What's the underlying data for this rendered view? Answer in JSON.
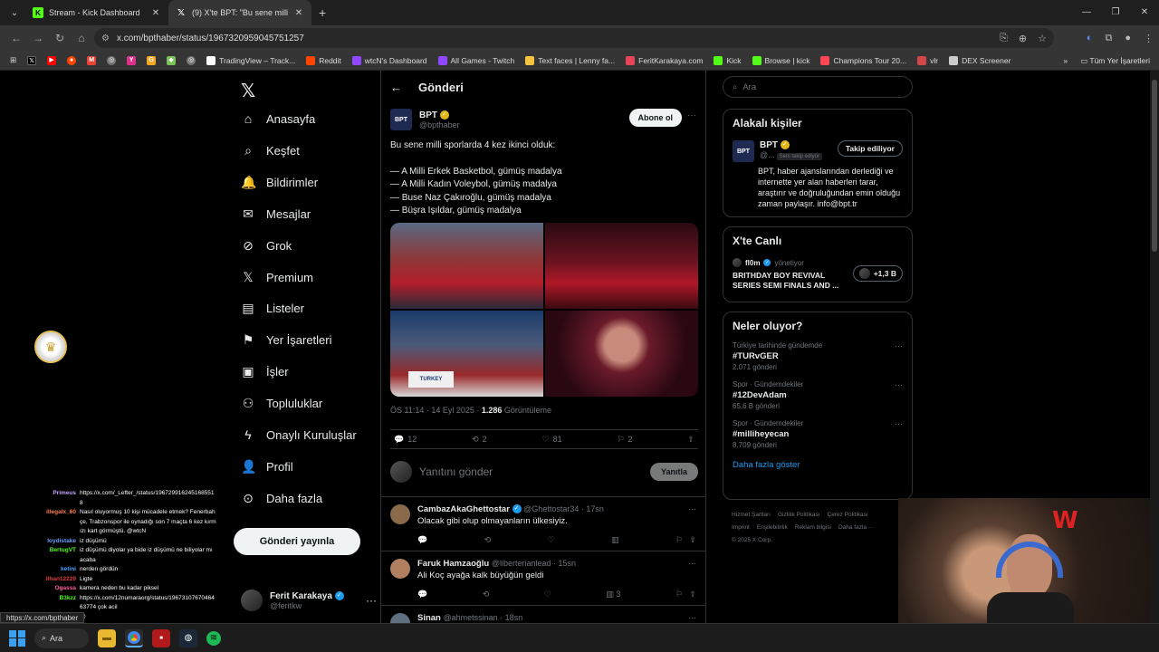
{
  "browser": {
    "tabs": [
      {
        "title": "Stream - Kick Dashboard",
        "favicon": "K",
        "color": "#53fc18"
      },
      {
        "title": "(9) X'te BPT: \"Bu sene milli spor",
        "favicon": "X",
        "color": "#ffffff"
      }
    ],
    "url": "x.com/bpthaber/status/1967320959045751257",
    "bookmarks": [
      {
        "label": "TradingView – Track...",
        "color": "#ffffff"
      },
      {
        "label": "Reddit",
        "color": "#ff4500"
      },
      {
        "label": "wtcN's Dashboard",
        "color": "#9146ff"
      },
      {
        "label": "All Games - Twitch",
        "color": "#9146ff"
      },
      {
        "label": "Text faces | Lenny fa...",
        "color": "#f5c542"
      },
      {
        "label": "FeritKarakaya.com",
        "color": "#e9445a"
      },
      {
        "label": "Kick",
        "color": "#53fc18"
      },
      {
        "label": "Browse | kick",
        "color": "#53fc18"
      },
      {
        "label": "Champions Tour 20...",
        "color": "#ff4655"
      },
      {
        "label": "vlr",
        "color": "#d04848"
      },
      {
        "label": "DEX Screener",
        "color": "#cccccc"
      }
    ],
    "bookmarks_all": "Tüm Yer İşaretleri",
    "status_url": "https://x.com/bpthaber"
  },
  "nav": {
    "items": [
      {
        "label": "Anasayfa",
        "icon": "home-icon",
        "glyph": "⌂"
      },
      {
        "label": "Keşfet",
        "icon": "search-icon",
        "glyph": "⌕"
      },
      {
        "label": "Bildirimler",
        "icon": "bell-icon",
        "glyph": "🔔"
      },
      {
        "label": "Mesajlar",
        "icon": "mail-icon",
        "glyph": "✉"
      },
      {
        "label": "Grok",
        "icon": "grok-icon",
        "glyph": "⊘"
      },
      {
        "label": "Premium",
        "icon": "x-premium-icon",
        "glyph": "𝕏"
      },
      {
        "label": "Listeler",
        "icon": "list-icon",
        "glyph": "▤"
      },
      {
        "label": "Yer İşaretleri",
        "icon": "bookmark-icon",
        "glyph": "⚑"
      },
      {
        "label": "İşler",
        "icon": "briefcase-icon",
        "glyph": "▣"
      },
      {
        "label": "Topluluklar",
        "icon": "communities-icon",
        "glyph": "⚇"
      },
      {
        "label": "Onaylı Kuruluşlar",
        "icon": "lightning-icon",
        "glyph": "ϟ"
      },
      {
        "label": "Profil",
        "icon": "profile-icon",
        "glyph": "👤"
      },
      {
        "label": "Daha fazla",
        "icon": "more-circle-icon",
        "glyph": "⊙"
      }
    ],
    "post_button": "Gönderi yayınla",
    "account": {
      "name": "Ferit Karakaya",
      "handle": "@feritkw"
    }
  },
  "post": {
    "header": "Gönderi",
    "author": {
      "name": "BPT",
      "handle": "@bpthaber",
      "logo": "BPT"
    },
    "subscribe": "Abone ol",
    "text_intro": "Bu sene milli sporlarda 4 kez ikinci olduk:",
    "text_lines": [
      "— A Milli Erkek Basketbol, gümüş madalya",
      "— A Milli Kadın Voleybol, gümüş madalya",
      "— Buse Naz Çakıroğlu, gümüş madalya",
      "— Büşra Işıldar, gümüş madalya"
    ],
    "media_sign": "TURKEY",
    "time": "ÖS 11:14 · 14 Eyl 2025 · ",
    "views": "1.286",
    "views_label": " Görüntüleme",
    "stats": {
      "replies": "12",
      "reposts": "2",
      "likes": "81",
      "bookmarks": "2"
    },
    "reply_placeholder": "Yanıtını gönder",
    "reply_button": "Yanıtla"
  },
  "replies": [
    {
      "name": "CambazAkaGhettostar",
      "handle": "@Ghettostar34 · 17sn",
      "text": "Olacak gibi olup olmayanların ülkesiyiz.",
      "avatar": "#8a6a4a",
      "views": ""
    },
    {
      "name": "Faruk Hamzaoğlu",
      "handle": "@liberterianlead · 15sn",
      "text": "Ali Koç ayağa kalk büyüğün geldi",
      "avatar": "#b08060",
      "views": "3"
    },
    {
      "name": "Sinan",
      "handle": "@ahmetssinan · 18sn",
      "text": "",
      "avatar": "#607080",
      "views": ""
    }
  ],
  "right": {
    "search_placeholder": "Ara",
    "relevant_title": "Alakalı kişiler",
    "relevant": {
      "name": "BPT",
      "handle": "@...",
      "following_tag": "Seni takip ediyor",
      "button": "Takip ediliyor",
      "bio": "BPT, haber ajanslarından derlediği ve internette yer alan haberleri tarar, araştırır ve doğruluğundan emin olduğu zaman paylaşır. info@bpt.tr"
    },
    "live_title": "X'te Canlı",
    "live": {
      "host": "fl0m",
      "host_suffix": "yönetiyor",
      "title": "BRITHDAY BOY REVIVAL SERIES SEMI FINALS AND ...",
      "count": "+1,3 B"
    },
    "trends_title": "Neler oluyor?",
    "trends": [
      {
        "category": "Türkiye tarihinde gündemde",
        "tag": "#TURvGER",
        "count": "2.071 gönderi"
      },
      {
        "category": "Spor · Gündemdekiler",
        "tag": "#12DevAdam",
        "count": "65,6 B gönderi"
      },
      {
        "category": "Spor · Gündemdekiler",
        "tag": "#milliheyecan",
        "count": "8.709 gönderi"
      }
    ],
    "show_more": "Daha fazla göster",
    "footer": [
      "Hizmet Şartları",
      "Gizlilik Politikası",
      "Çerez Politikası",
      "Imprint",
      "Erişilebilirlik",
      "Reklam bilgisi",
      "Daha fazla ···",
      "© 2025 X Corp."
    ]
  },
  "chat": [
    {
      "user": "Primeus",
      "color": "#c8a2ff",
      "msg": "https://x.com/_Lefter_/status/1967299162451685518"
    },
    {
      "user": "illegalx_60",
      "color": "#ff7f50",
      "msg": "Nasıl oluyormuş 10 kişi mücadele etmek? Fenerbahçe, Trabzonspor ile oynadığı son 7 maçta 6 kez kırmızı kart görmüştü. @wtcN"
    },
    {
      "user": "loydistake",
      "color": "#6aa0ff",
      "msg": "iz düşümü"
    },
    {
      "user": "BertugVT",
      "color": "#53fc18",
      "msg": "iz düşümü diyolar ya bide iz düşümü ne biliyolar mı acaba"
    },
    {
      "user": "ketini",
      "color": "#4aa0ff",
      "msg": "nerden gördün"
    },
    {
      "user": "Ilhan12229",
      "color": "#e04040",
      "msg": "Ligte"
    },
    {
      "user": "Ogassa",
      "color": "#ff5fa0",
      "msg": "kamera neden bu kadar piksel"
    },
    {
      "user": "B3kzz",
      "color": "#53fc18",
      "msg": "https://x.com/12numaraorg/status/1967310767046463774 çok acil"
    },
    {
      "user": "Streatoh",
      "color": "#c0c0ff",
      "msg": "🙃"
    }
  ],
  "taskbar": {
    "search": "Ara"
  }
}
